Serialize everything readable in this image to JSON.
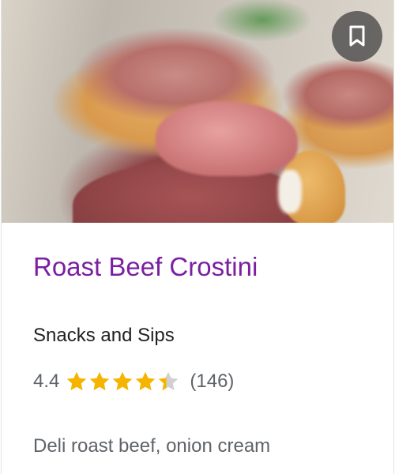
{
  "card": {
    "image_icon": "bookmark-icon",
    "title": "Roast Beef Crostini",
    "source": "Snacks and Sips",
    "rating": {
      "value_text": "4.4",
      "value": 4.4,
      "max": 5,
      "reviews_text": "(146)"
    },
    "description": "Deli roast beef, onion cream"
  },
  "colors": {
    "title": "#7b1fa2",
    "star": "#f5b400",
    "star_empty": "#d0d0d0",
    "text_secondary": "#5f6368",
    "text_primary": "#202124"
  }
}
